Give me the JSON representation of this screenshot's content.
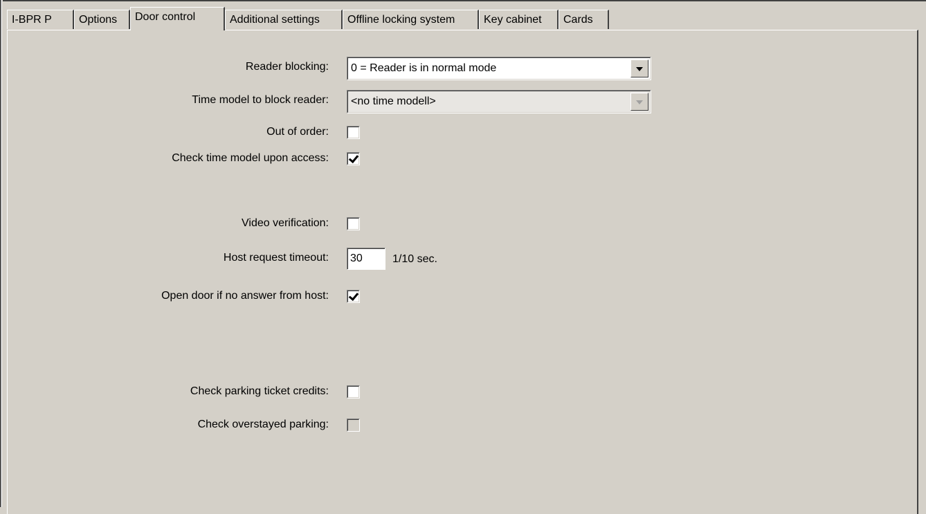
{
  "tabs": [
    {
      "label": "I-BPR P",
      "active": false
    },
    {
      "label": "Options",
      "active": false
    },
    {
      "label": "Door control",
      "active": true
    },
    {
      "label": "Additional settings",
      "active": false
    },
    {
      "label": "Offline locking system",
      "active": false
    },
    {
      "label": "Key cabinet",
      "active": false
    },
    {
      "label": "Cards",
      "active": false
    }
  ],
  "form": {
    "reader_blocking": {
      "label": "Reader blocking:",
      "value": "0 = Reader is in normal mode"
    },
    "time_model_block": {
      "label": "Time model to block reader:",
      "value": "<no time modell>",
      "disabled": true
    },
    "out_of_order": {
      "label": "Out of order:",
      "checked": false
    },
    "check_time_model": {
      "label": "Check time model upon access:",
      "checked": true
    },
    "video_verification": {
      "label": "Video verification:",
      "checked": false
    },
    "host_request_timeout": {
      "label": "Host request timeout:",
      "value": "30",
      "unit": "1/10 sec."
    },
    "open_door_no_answer": {
      "label": "Open door if no answer from host:",
      "checked": true
    },
    "check_parking_credits": {
      "label": "Check parking ticket credits:",
      "checked": false
    },
    "check_overstayed": {
      "label": "Check overstayed parking:",
      "checked": false,
      "disabled": true
    }
  }
}
